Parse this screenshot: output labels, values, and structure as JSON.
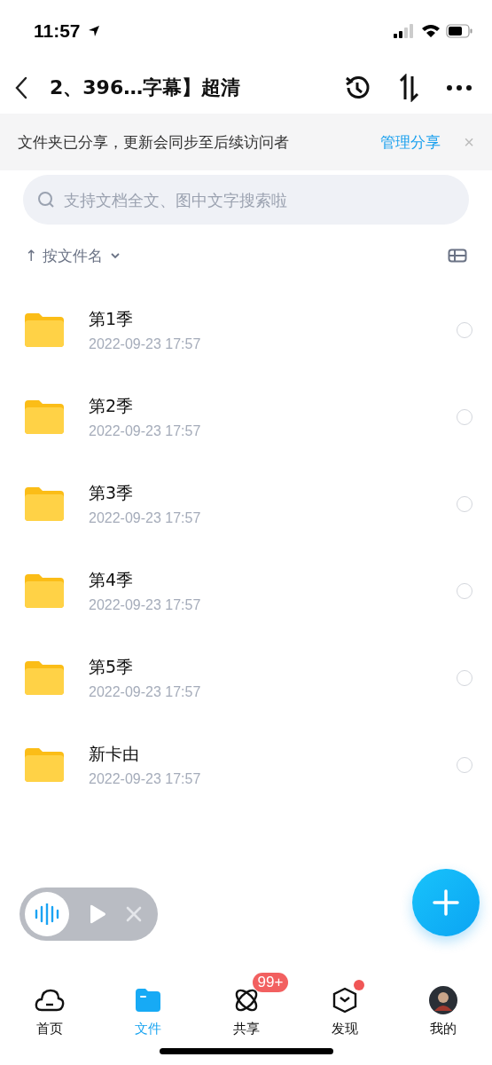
{
  "status_bar": {
    "time": "11:57"
  },
  "nav": {
    "title": "2、396…字幕】超清"
  },
  "share_banner": {
    "text": "文件夹已分享，更新会同步至后续访问者",
    "action": "管理分享",
    "close": "×"
  },
  "search": {
    "placeholder": "支持文档全文、图中文字搜索啦"
  },
  "sort": {
    "arrow": "↑",
    "label": "按文件名"
  },
  "files": [
    {
      "name": "第1季",
      "date": "2022-09-23 17:57",
      "selected": false
    },
    {
      "name": "第2季",
      "date": "2022-09-23 17:57",
      "selected": false
    },
    {
      "name": "第3季",
      "date": "2022-09-23 17:57",
      "selected": false
    },
    {
      "name": "第4季",
      "date": "2022-09-23 17:57",
      "selected": false
    },
    {
      "name": "第5季",
      "date": "2022-09-23 17:57",
      "selected": false
    },
    {
      "name": "新卡由",
      "date": "2022-09-23 17:57",
      "selected": false
    }
  ],
  "tabs": [
    {
      "kind": "home",
      "label": "首页",
      "selected": false
    },
    {
      "kind": "files",
      "label": "文件",
      "selected": true
    },
    {
      "kind": "share",
      "label": "共享",
      "selected": false,
      "badge": "99+"
    },
    {
      "kind": "discover",
      "label": "发现",
      "selected": false,
      "dot": true
    },
    {
      "kind": "me",
      "label": "我的",
      "selected": false
    }
  ]
}
